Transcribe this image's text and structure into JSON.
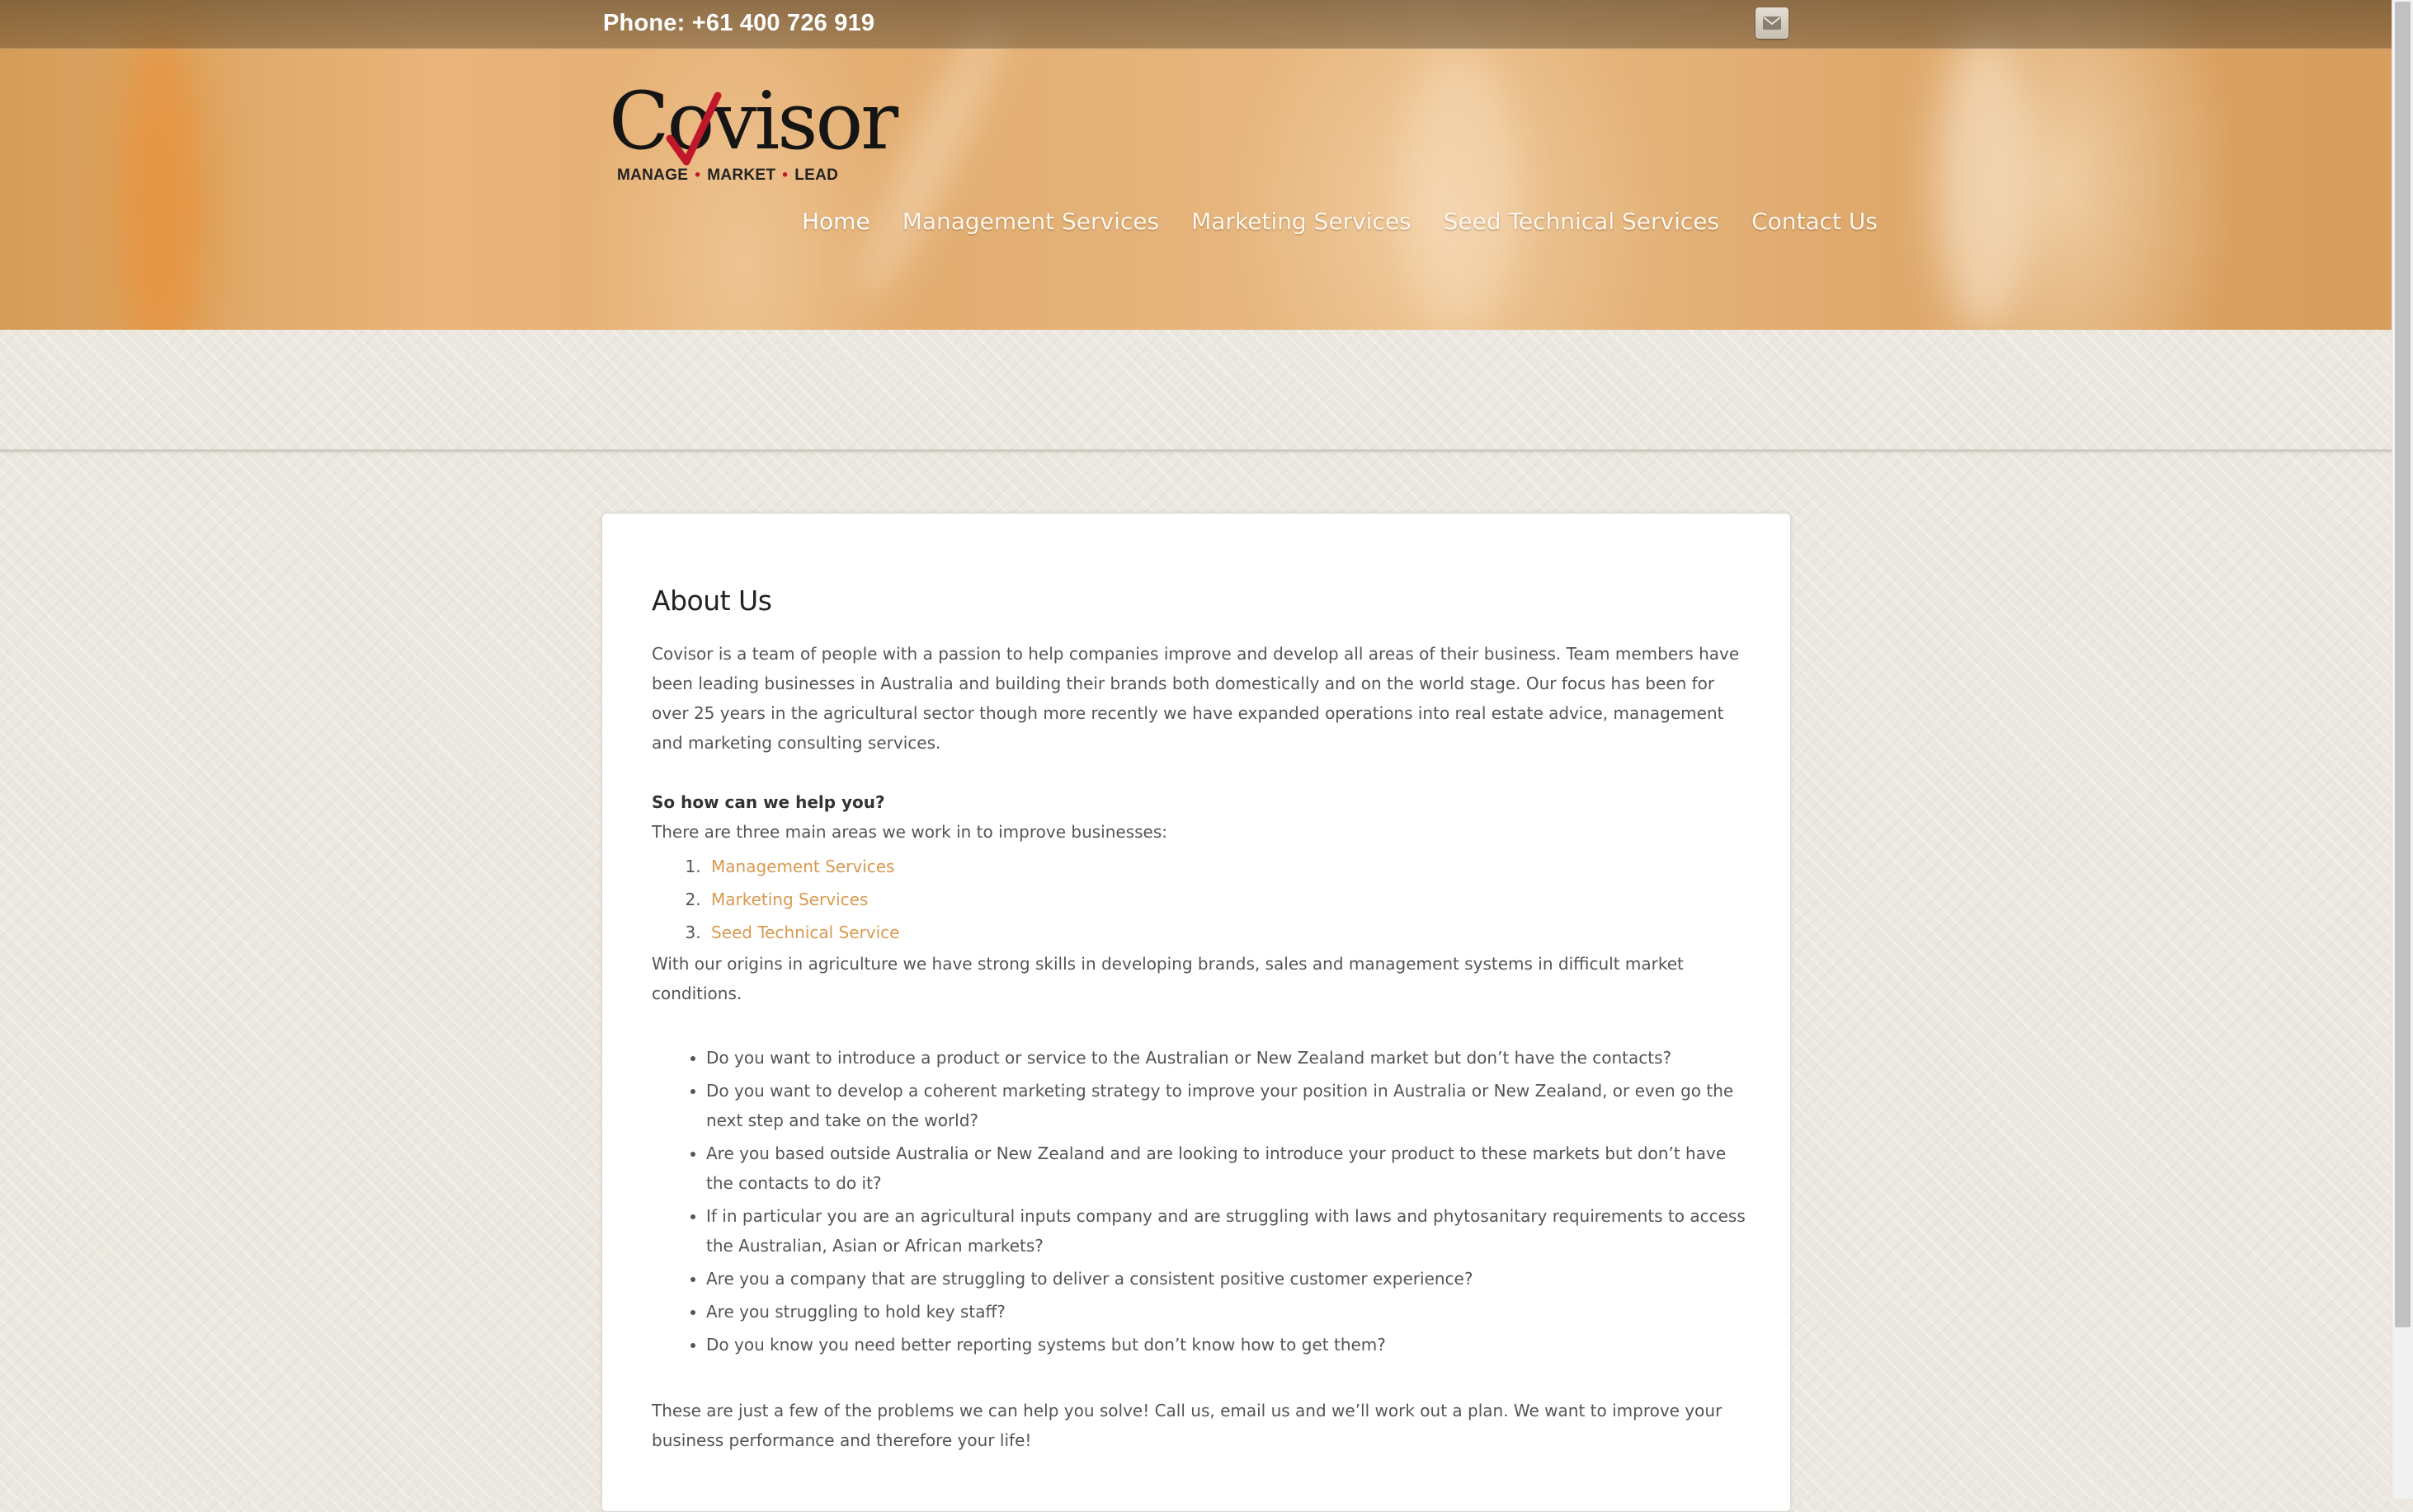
{
  "topbar": {
    "phone": "Phone: +61 400 726 919",
    "mail_icon": "mail-icon"
  },
  "logo": {
    "wordmark": "Covisor",
    "tagline": [
      "MANAGE",
      "MARKET",
      "LEAD"
    ]
  },
  "nav": {
    "items": [
      {
        "label": "Home",
        "active": true
      },
      {
        "label": "Management Services"
      },
      {
        "label": "Marketing Services"
      },
      {
        "label": "Seed Technical Services"
      },
      {
        "label": "Contact Us"
      }
    ]
  },
  "main": {
    "title": "About Us",
    "intro": "Covisor is a team of people with a passion to help companies improve and develop all areas of their business. Team members have been leading businesses in Australia and building their brands both domestically and on the world stage. Our focus has been for over 25 years in the agricultural sector though more recently we have expanded operations into real estate advice, management and marketing consulting services.",
    "question": "So how can we help you?",
    "areas_intro": "There are three main areas we work in to improve businesses:",
    "areas": [
      "Management Services",
      "Marketing Services",
      "Seed Technical Service"
    ],
    "origins": "With our origins in agriculture we have strong skills in developing brands, sales and management systems in difficult market conditions.",
    "bullets": [
      "Do you want to introduce a product or service to the Australian or New Zealand market but don’t have the contacts?",
      "Do you want to develop a coherent marketing strategy to improve your position in Australia or New Zealand, or even go the next step and take on the world?",
      "Are you based outside Australia or New Zealand and are looking to introduce your product to these markets but don’t have the contacts to do it?",
      "If in particular you are an agricultural inputs company and are struggling with laws and phytosanitary requirements to access the Australian, Asian or African markets?",
      "Are you a company that are struggling to deliver a consistent positive customer experience?",
      "Are you struggling to hold key staff?",
      "Do you know you need better reporting systems but don’t know how to get them?"
    ],
    "closing": "These are just a few of the problems we can help you solve! Call us, email us and we’ll work out a plan. We want to improve your business performance and therefore your life!"
  },
  "colors": {
    "link": "#d9994f",
    "header_bg": "#e3ae72",
    "logo_red": "#c0182a"
  }
}
